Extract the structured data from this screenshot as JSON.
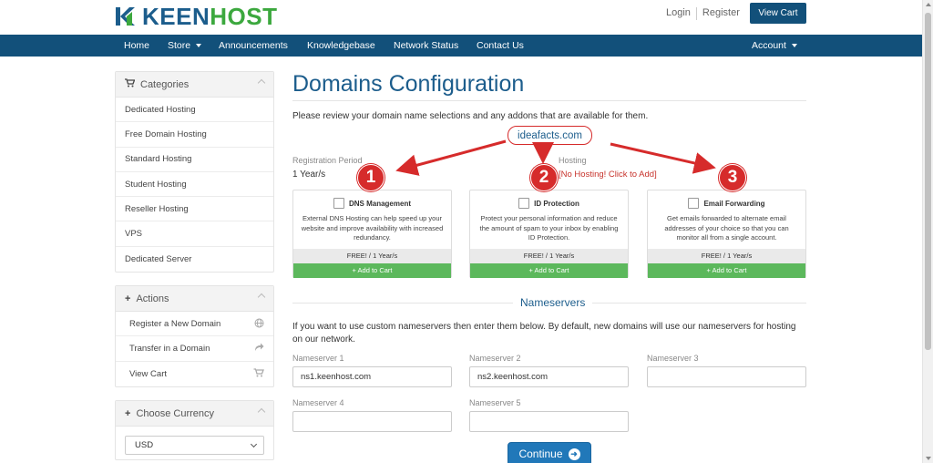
{
  "header": {
    "logo_text": "KEENHOST",
    "login": "Login",
    "register": "Register",
    "view_cart": "View Cart"
  },
  "nav": {
    "home": "Home",
    "store": "Store",
    "announcements": "Announcements",
    "knowledgebase": "Knowledgebase",
    "network_status": "Network Status",
    "contact_us": "Contact Us",
    "account": "Account"
  },
  "sidebar": {
    "categories_title": "Categories",
    "categories": [
      "Dedicated Hosting",
      "Free Domain Hosting",
      "Standard Hosting",
      "Student Hosting",
      "Reseller Hosting",
      "VPS",
      "Dedicated Server"
    ],
    "actions_title": "Actions",
    "actions": [
      "Register a New Domain",
      "Transfer in a Domain",
      "View Cart"
    ],
    "currency_title": "Choose Currency",
    "currency_value": "USD"
  },
  "main": {
    "title": "Domains Configuration",
    "intro": "Please review your domain name selections and any addons that are available for them.",
    "domain": "ideafacts.com",
    "registration_period_label": "Registration Period",
    "registration_period_value": "1 Year/s",
    "hosting_label": "Hosting",
    "hosting_value": "[No Hosting! Click to Add]",
    "addons": [
      {
        "title": "DNS Management",
        "desc": "External DNS Hosting can help speed up your website and improve availability with increased redundancy.",
        "price": "FREE! / 1 Year/s",
        "button": "+ Add to Cart",
        "badge": "1"
      },
      {
        "title": "ID Protection",
        "desc": "Protect your personal information and reduce the amount of spam to your inbox by enabling ID Protection.",
        "price": "FREE! / 1 Year/s",
        "button": "+ Add to Cart",
        "badge": "2"
      },
      {
        "title": "Email Forwarding",
        "desc": "Get emails forwarded to alternate email addresses of your choice so that you can monitor all from a single account.",
        "price": "FREE! / 1 Year/s",
        "button": "+ Add to Cart",
        "badge": "3"
      }
    ],
    "nameservers_title": "Nameservers",
    "nameservers_text": "If you want to use custom nameservers then enter them below. By default, new domains will use our nameservers for hosting on our network.",
    "nameservers": [
      {
        "label": "Nameserver 1",
        "value": "ns1.keenhost.com"
      },
      {
        "label": "Nameserver 2",
        "value": "ns2.keenhost.com"
      },
      {
        "label": "Nameserver 3",
        "value": ""
      },
      {
        "label": "Nameserver 4",
        "value": ""
      },
      {
        "label": "Nameserver 5",
        "value": ""
      }
    ],
    "continue": "Continue"
  },
  "colors": {
    "brand_blue": "#12507a",
    "brand_green": "#3ca83e",
    "annotation_red": "#d62b2b",
    "add_green": "#5cb85c",
    "continue_blue": "#2178b9"
  }
}
